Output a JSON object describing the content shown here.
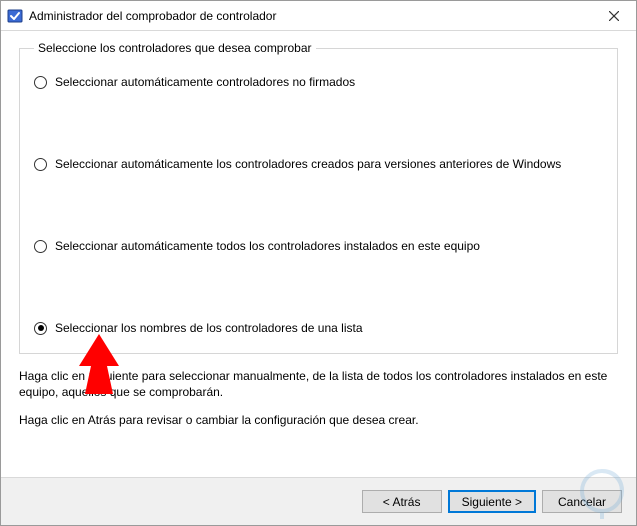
{
  "window": {
    "title": "Administrador del comprobador de controlador"
  },
  "group": {
    "legend": "Seleccione los controladores que desea comprobar",
    "options": [
      {
        "label": "Seleccionar automáticamente controladores no firmados"
      },
      {
        "label": "Seleccionar automáticamente los controladores creados para versiones anteriores de Windows"
      },
      {
        "label": "Seleccionar automáticamente todos los controladores instalados en este equipo"
      },
      {
        "label": "Seleccionar los nombres de los controladores de una lista"
      }
    ],
    "selected_index": 3
  },
  "help": {
    "line1": "Haga clic en Siguiente para seleccionar manualmente, de la lista de todos los controladores instalados en este equipo, aquellos que se comprobarán.",
    "line2": "Haga clic en Atrás para revisar o cambiar la configuración que desea crear."
  },
  "buttons": {
    "back": "< Atrás",
    "next": "Siguiente >",
    "cancel": "Cancelar"
  },
  "overlay": {
    "arrow_color": "#ff0000"
  }
}
